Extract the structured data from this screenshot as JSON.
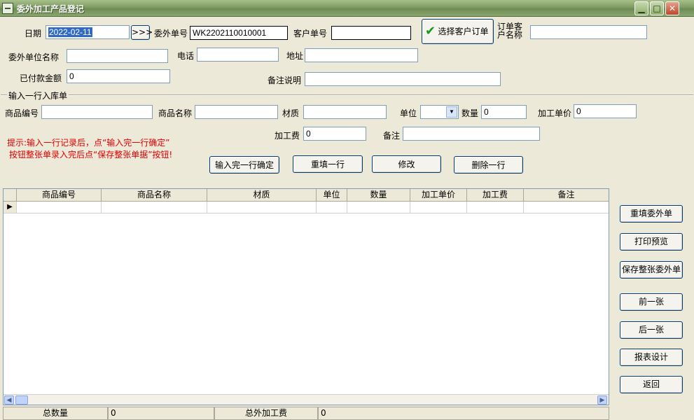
{
  "window": {
    "title": "委外加工产品登记",
    "min_label": "▁",
    "max_label": "□",
    "close_label": "✕"
  },
  "header": {
    "date_label": "日期",
    "date_value": "2022-02-11",
    "date_button": ">>>",
    "order_no_label": "委外单号",
    "order_no_value": "WK2202110010001",
    "customer_no_label": "客户单号",
    "customer_no_value": "",
    "choose_button": "选择客户订单",
    "order_customer_label_1": "订单客",
    "order_customer_label_2": "户名称",
    "order_customer_value": "",
    "unit_name_label": "委外单位名称",
    "unit_name_value": "",
    "phone_label": "电话",
    "phone_value": "",
    "address_label": "地址",
    "address_value": "",
    "paid_label": "已付款金额",
    "paid_value": "0",
    "remark_label": "备注说明",
    "remark_value": ""
  },
  "entry": {
    "group_label": "输入一行入库单",
    "code_label": "商品编号",
    "code_value": "",
    "name_label": "商品名称",
    "name_value": "",
    "material_label": "材质",
    "material_value": "",
    "unit_label": "单位",
    "unit_value": "",
    "qty_label": "数量",
    "qty_value": "0",
    "price_label": "加工单价",
    "price_value": "0",
    "fee_label": "加工费",
    "fee_value": "0",
    "note_label": "备注",
    "note_value": "",
    "hint_1": "提示:输入一行记录后，点“输入完一行确定”",
    "hint_2": "按钮整张单录入完后点“保存整张单据”按钮!",
    "btn_confirm": "输入完一行确定",
    "btn_refill": "重填一行",
    "btn_modify": "修改",
    "btn_delete": "删除一行"
  },
  "table": {
    "columns": [
      "商品编号",
      "商品名称",
      "材质",
      "单位",
      "数量",
      "加工单价",
      "加工费",
      "备注"
    ],
    "row_indicator": "▶"
  },
  "side_buttons": {
    "refill_order": "重填委外单",
    "print_preview": "打印预览",
    "save_order": "保存整张委外单",
    "prev": "前一张",
    "next": "后一张",
    "report_design": "报表设计",
    "back": "返回"
  },
  "footer": {
    "total_qty_label": "总数量",
    "total_qty_value": "0",
    "total_fee_label": "总外加工费",
    "total_fee_value": "0"
  },
  "colors": {
    "accent": "#316ac5",
    "hint": "#e00000",
    "check": "#1a9a1a"
  }
}
